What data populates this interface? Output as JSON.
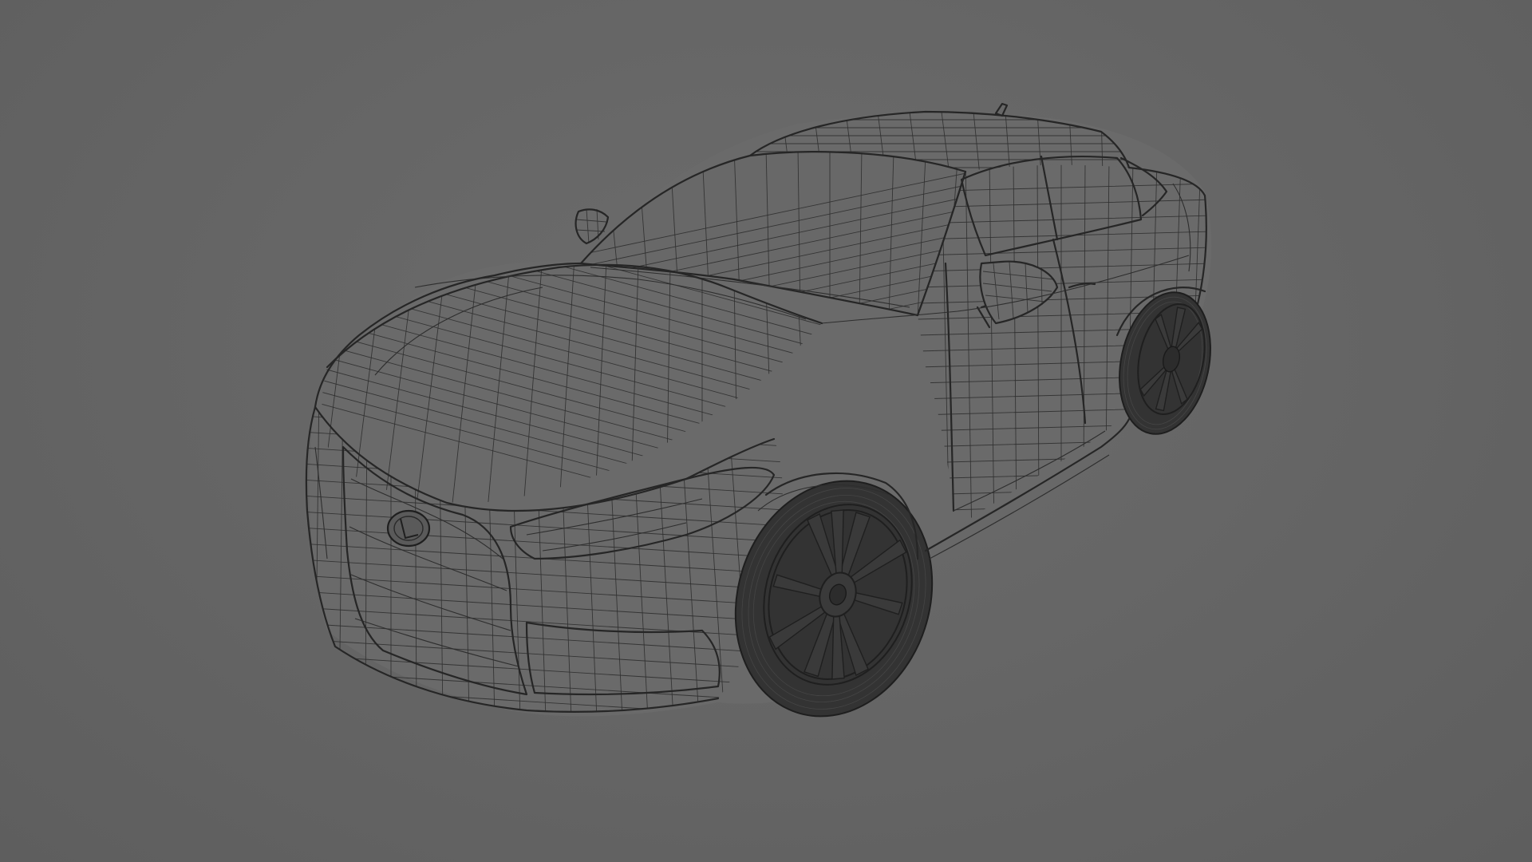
{
  "scene": {
    "background_color": "#666666",
    "wire_color": "#2f2f2f",
    "subject": "car-wireframe"
  }
}
